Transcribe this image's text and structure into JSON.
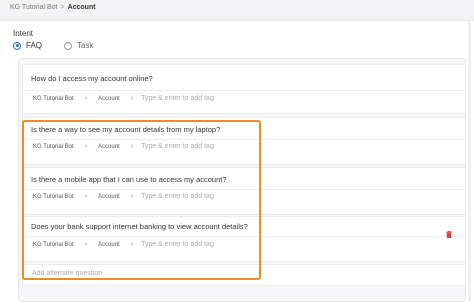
{
  "breadcrumb": {
    "root": "KG Tutorial Bot",
    "separator": ">",
    "current": "Account"
  },
  "intent": {
    "label": "Intent",
    "options": [
      {
        "label": "FAQ",
        "selected": true
      },
      {
        "label": "Task",
        "selected": false
      }
    ]
  },
  "questions": [
    {
      "text": "How do I access my account online?",
      "tags": [
        "KG Tutorial Bot",
        "Account"
      ],
      "tag_placeholder": "Type & enter to add tag"
    },
    {
      "text": "Is there a way to see my account details from my laptop?",
      "tags": [
        "KG Tutorial Bot",
        "Account"
      ],
      "tag_placeholder": "Type & enter to add tag"
    },
    {
      "text": "Is there a mobile app that I can use to access my account?",
      "tags": [
        "KG Tutorial Bot",
        "Account"
      ],
      "tag_placeholder": "Type & enter to add tag"
    },
    {
      "text": "Does your bank support internet banking to view account details?",
      "tags": [
        "KG Tutorial Bot",
        "Account"
      ],
      "tag_placeholder": "Type & enter to add tag"
    }
  ],
  "alternate": {
    "placeholder": "Add alternate question"
  },
  "icons": {
    "delete": "trash-icon",
    "chevron": "chevron-right-icon"
  },
  "colors": {
    "accent": "#2f6fd6",
    "highlight": "#f08a24",
    "delete": "#e53935"
  }
}
